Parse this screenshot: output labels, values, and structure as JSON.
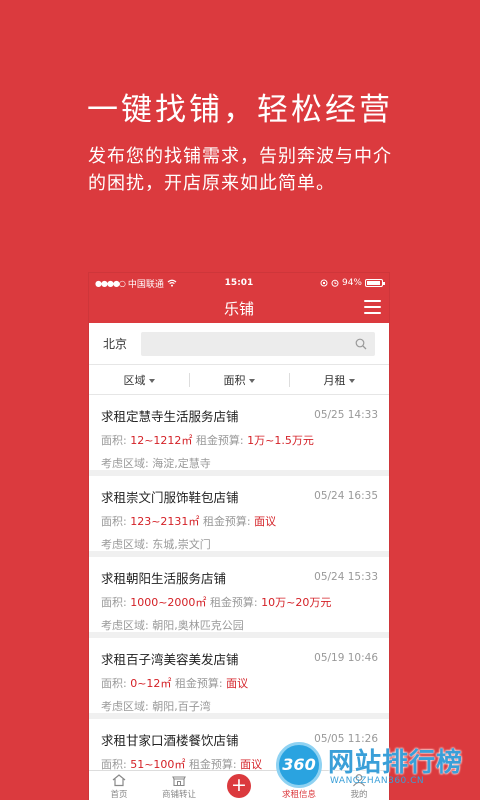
{
  "promo": {
    "title": "一键找铺，轻松经营",
    "subtitle_line1": "发布您的找铺需求，告别奔波与中介",
    "subtitle_line2": "的困扰，开店原来如此简单。"
  },
  "status_bar": {
    "signal": "●●●●○",
    "carrier": "中国联通",
    "time": "15:01",
    "battery": "94%",
    "battery_level": 0.94
  },
  "app_bar": {
    "title": "乐铺"
  },
  "search": {
    "city": "北京",
    "placeholder": ""
  },
  "filters": [
    {
      "label": "区域"
    },
    {
      "label": "面积"
    },
    {
      "label": "月租"
    }
  ],
  "listings": [
    {
      "title": "求租定慧寺生活服务店铺",
      "date": "05/25 14:33",
      "area_label": "面积:",
      "area_value": "12~1212㎡",
      "budget_label": "租金预算:",
      "budget_value": "1万~1.5万元",
      "region": "考虑区域: 海淀,定慧寺"
    },
    {
      "title": "求租崇文门服饰鞋包店铺",
      "date": "05/24 16:35",
      "area_label": "面积:",
      "area_value": "123~2131㎡",
      "budget_label": "租金预算:",
      "budget_value": "面议",
      "region": "考虑区域: 东城,崇文门"
    },
    {
      "title": "求租朝阳生活服务店铺",
      "date": "05/24 15:33",
      "area_label": "面积:",
      "area_value": "1000~2000㎡",
      "budget_label": "租金预算:",
      "budget_value": "10万~20万元",
      "region": "考虑区域: 朝阳,奥林匹克公园"
    },
    {
      "title": "求租百子湾美容美发店铺",
      "date": "05/19 10:46",
      "area_label": "面积:",
      "area_value": "0~12㎡",
      "budget_label": "租金预算:",
      "budget_value": "面议",
      "region": "考虑区域: 朝阳,百子湾"
    },
    {
      "title": "求租甘家口酒楼餐饮店铺",
      "date": "05/05 11:26",
      "area_label": "面积:",
      "area_value": "51~100㎡",
      "budget_label": "租金预算:",
      "budget_value": "面议",
      "region": ""
    }
  ],
  "tabs": [
    {
      "label": "首页",
      "icon": "home-icon"
    },
    {
      "label": "商铺转让",
      "icon": "shop-icon"
    },
    {
      "label": "",
      "icon": "plus-icon"
    },
    {
      "label": "求租信息",
      "icon": "message-icon"
    },
    {
      "label": "我的",
      "icon": "person-icon"
    }
  ],
  "watermark": {
    "badge": "360",
    "text": "网站排行榜",
    "url": "WANGZHAN360.CN"
  },
  "colors": {
    "brand_red": "#db3a3e",
    "highlight_red": "#d42127",
    "watermark_blue": "#3a9fd8"
  }
}
